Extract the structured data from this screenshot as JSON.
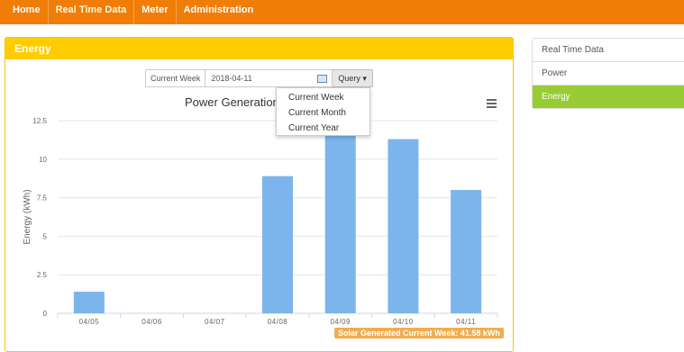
{
  "topnav": {
    "items": [
      {
        "label": "Home"
      },
      {
        "label": "Real Time Data"
      },
      {
        "label": "Meter"
      },
      {
        "label": "Administration"
      }
    ],
    "active": "Real Time Data"
  },
  "panel": {
    "title": "Energy",
    "query": {
      "label": "Current Week",
      "date_value": "2018-04-11",
      "button_label": "Query",
      "dropdown_options": [
        "Current Week",
        "Current Month",
        "Current Year"
      ]
    },
    "badge_text": "Solar Generated Current Week: 41.58 kWh"
  },
  "sidenav": {
    "items": [
      {
        "label": "Real Time Data"
      },
      {
        "label": "Power"
      },
      {
        "label": "Energy"
      }
    ],
    "active_index": 2
  },
  "colors": {
    "topnav": "#f07d08",
    "panel_header": "#ffcc00",
    "bar": "#7cb5ec",
    "sidenav_active": "#99cc33",
    "badge": "#f0ad4e"
  },
  "chart_data": {
    "type": "bar",
    "title": "Power Generation",
    "ylabel": "Energy (kWh)",
    "xlabel": "",
    "categories": [
      "04/05",
      "04/06",
      "04/07",
      "04/08",
      "04/09",
      "04/10",
      "04/11"
    ],
    "values": [
      1.4,
      0,
      0,
      8.9,
      12.0,
      11.3,
      8.0
    ],
    "ylim": [
      0,
      12.5
    ],
    "yticks": [
      0,
      2.5,
      5,
      7.5,
      10,
      12.5
    ],
    "ytick_labels": [
      "0",
      "2.5",
      "5",
      "7.5",
      "10",
      "12.5"
    ],
    "grid": true,
    "legend": "none"
  }
}
